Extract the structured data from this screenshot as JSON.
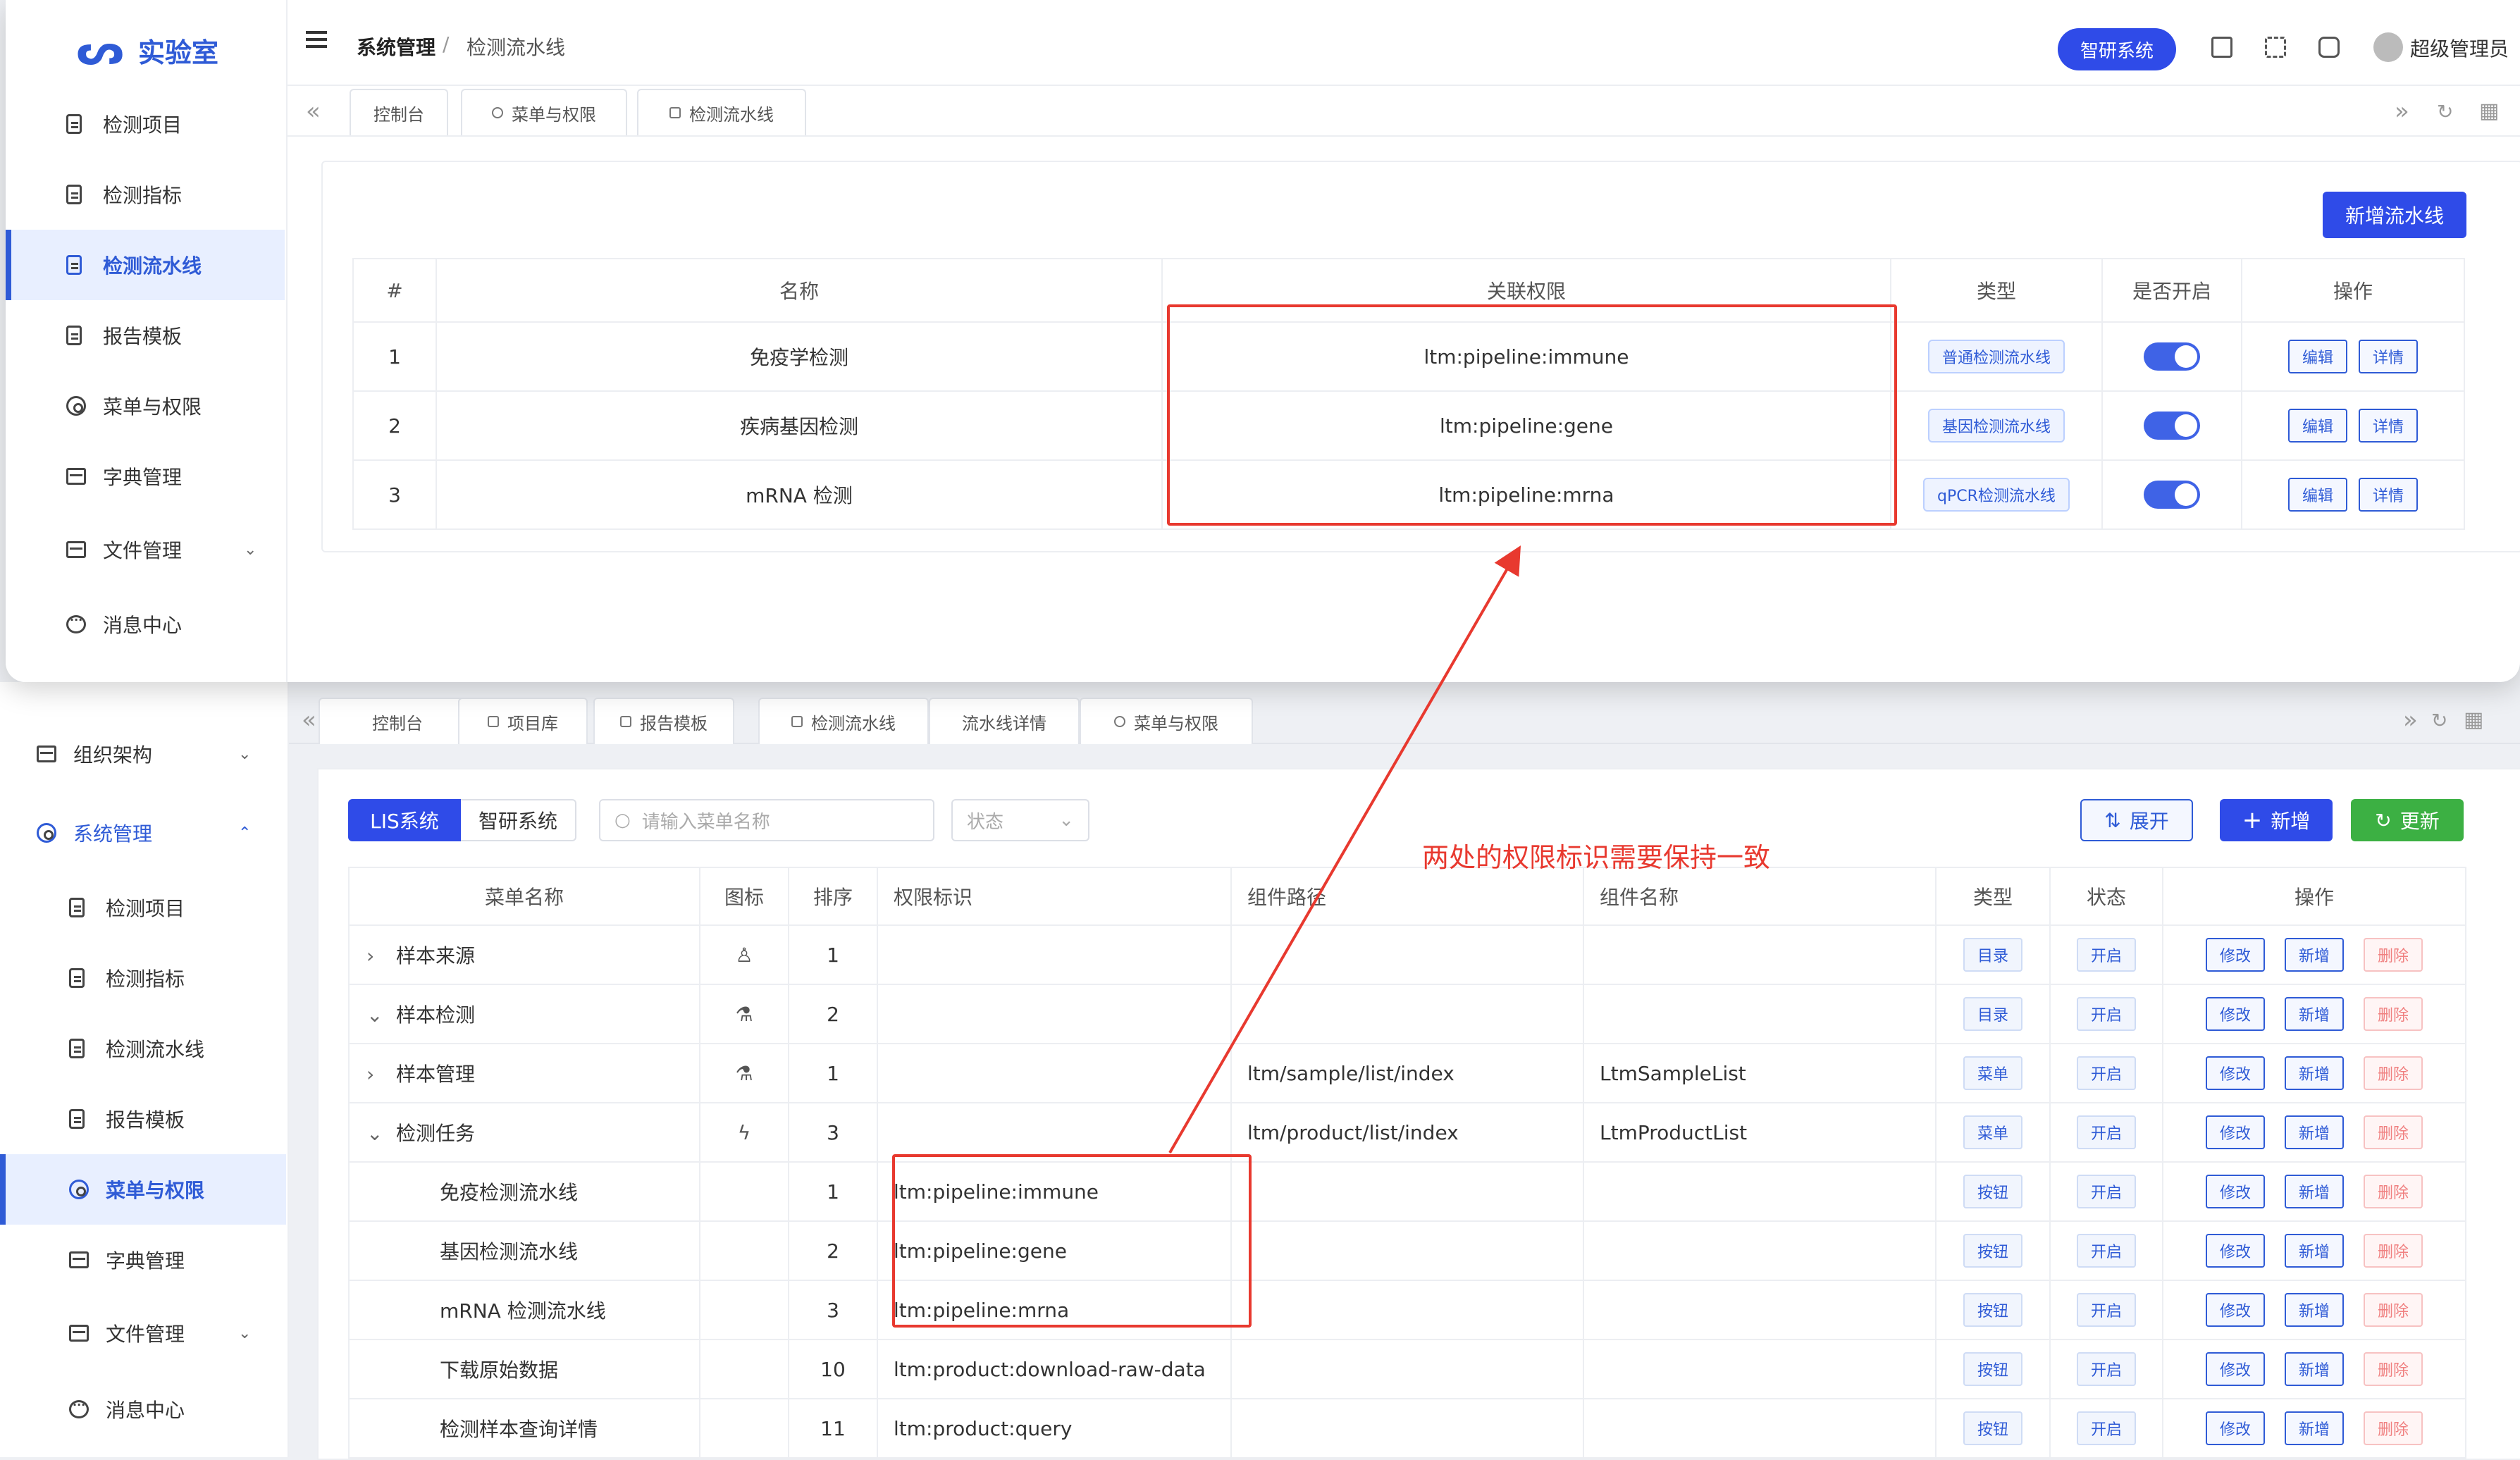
{
  "app": {
    "logo_text": "实验室"
  },
  "header": {
    "breadcrumb_parent": "系统管理",
    "breadcrumb_sep": "/",
    "breadcrumb_current": "检测流水线",
    "system_button": "智研系统",
    "username": "超级管理员"
  },
  "sidebar1": {
    "items": [
      {
        "label": "检测项目"
      },
      {
        "label": "检测指标"
      },
      {
        "label": "检测流水线"
      },
      {
        "label": "报告模板"
      },
      {
        "label": "菜单与权限"
      },
      {
        "label": "字典管理"
      },
      {
        "label": "文件管理"
      },
      {
        "label": "消息中心"
      }
    ]
  },
  "tabs1": {
    "items": [
      "控制台",
      "菜单与权限",
      "检测流水线"
    ]
  },
  "pipeline_page": {
    "add_button": "新增流水线",
    "columns": [
      "#",
      "名称",
      "关联权限",
      "类型",
      "是否开启",
      "操作"
    ],
    "rows": [
      {
        "idx": "1",
        "name": "免疫学检测",
        "perm": "ltm:pipeline:immune",
        "type": "普通检测流水线",
        "enabled": true
      },
      {
        "idx": "2",
        "name": "疾病基因检测",
        "perm": "ltm:pipeline:gene",
        "type": "基因检测流水线",
        "enabled": true
      },
      {
        "idx": "3",
        "name": "mRNA 检测",
        "perm": "ltm:pipeline:mrna",
        "type": "qPCR检测流水线",
        "enabled": true
      }
    ],
    "edit_label": "编辑",
    "detail_label": "详情"
  },
  "sidebar2": {
    "items": [
      {
        "label": "组织架构"
      },
      {
        "label": "系统管理"
      },
      {
        "label": "检测项目"
      },
      {
        "label": "检测指标"
      },
      {
        "label": "检测流水线"
      },
      {
        "label": "报告模板"
      },
      {
        "label": "菜单与权限"
      },
      {
        "label": "字典管理"
      },
      {
        "label": "文件管理"
      },
      {
        "label": "消息中心"
      }
    ]
  },
  "tabs2": {
    "items": [
      "控制台",
      "项目库",
      "报告模板",
      "检测流水线",
      "流水线详情",
      "菜单与权限"
    ]
  },
  "menu_page": {
    "seg_lis": "LIS系统",
    "seg_zy": "智研系统",
    "search_placeholder": "请输入菜单名称",
    "status_placeholder": "状态",
    "expand_button": "展开",
    "add_button": "新增",
    "refresh_button": "更新",
    "columns": [
      "菜单名称",
      "图标",
      "排序",
      "权限标识",
      "组件路径",
      "组件名称",
      "类型",
      "状态",
      "操作"
    ],
    "rows": [
      {
        "name": "样本来源",
        "order": "1",
        "perm": "",
        "path": "",
        "comp": "",
        "type": "目录",
        "status": "开启",
        "level": 0,
        "toggle": "›"
      },
      {
        "name": "样本检测",
        "order": "2",
        "perm": "",
        "path": "",
        "comp": "",
        "type": "目录",
        "status": "开启",
        "level": 0,
        "toggle": "⌄"
      },
      {
        "name": "样本管理",
        "order": "1",
        "perm": "",
        "path": "ltm/sample/list/index",
        "comp": "LtmSampleList",
        "type": "菜单",
        "status": "开启",
        "level": 1,
        "toggle": "›"
      },
      {
        "name": "检测任务",
        "order": "3",
        "perm": "",
        "path": "ltm/product/list/index",
        "comp": "LtmProductList",
        "type": "菜单",
        "status": "开启",
        "level": 1,
        "toggle": "⌄"
      },
      {
        "name": "免疫检测流水线",
        "order": "1",
        "perm": "ltm:pipeline:immune",
        "path": "",
        "comp": "",
        "type": "按钮",
        "status": "开启",
        "level": 2,
        "toggle": ""
      },
      {
        "name": "基因检测流水线",
        "order": "2",
        "perm": "ltm:pipeline:gene",
        "path": "",
        "comp": "",
        "type": "按钮",
        "status": "开启",
        "level": 2,
        "toggle": ""
      },
      {
        "name": "mRNA 检测流水线",
        "order": "3",
        "perm": "ltm:pipeline:mrna",
        "path": "",
        "comp": "",
        "type": "按钮",
        "status": "开启",
        "level": 2,
        "toggle": ""
      },
      {
        "name": "下载原始数据",
        "order": "10",
        "perm": "ltm:product:download-raw-data",
        "path": "",
        "comp": "",
        "type": "按钮",
        "status": "开启",
        "level": 2,
        "toggle": ""
      },
      {
        "name": "检测样本查询详情",
        "order": "11",
        "perm": "ltm:product:query",
        "path": "",
        "comp": "",
        "type": "按钮",
        "status": "开启",
        "level": 2,
        "toggle": ""
      }
    ],
    "modify_label": "修改",
    "add_label": "新增",
    "delete_label": "删除"
  },
  "annotation": {
    "note": "两处的权限标识需要保持一致",
    "color": "#e8392f"
  },
  "colors": {
    "primary": "#2f4be8",
    "success": "#3cb043",
    "danger": "#e8392f"
  }
}
